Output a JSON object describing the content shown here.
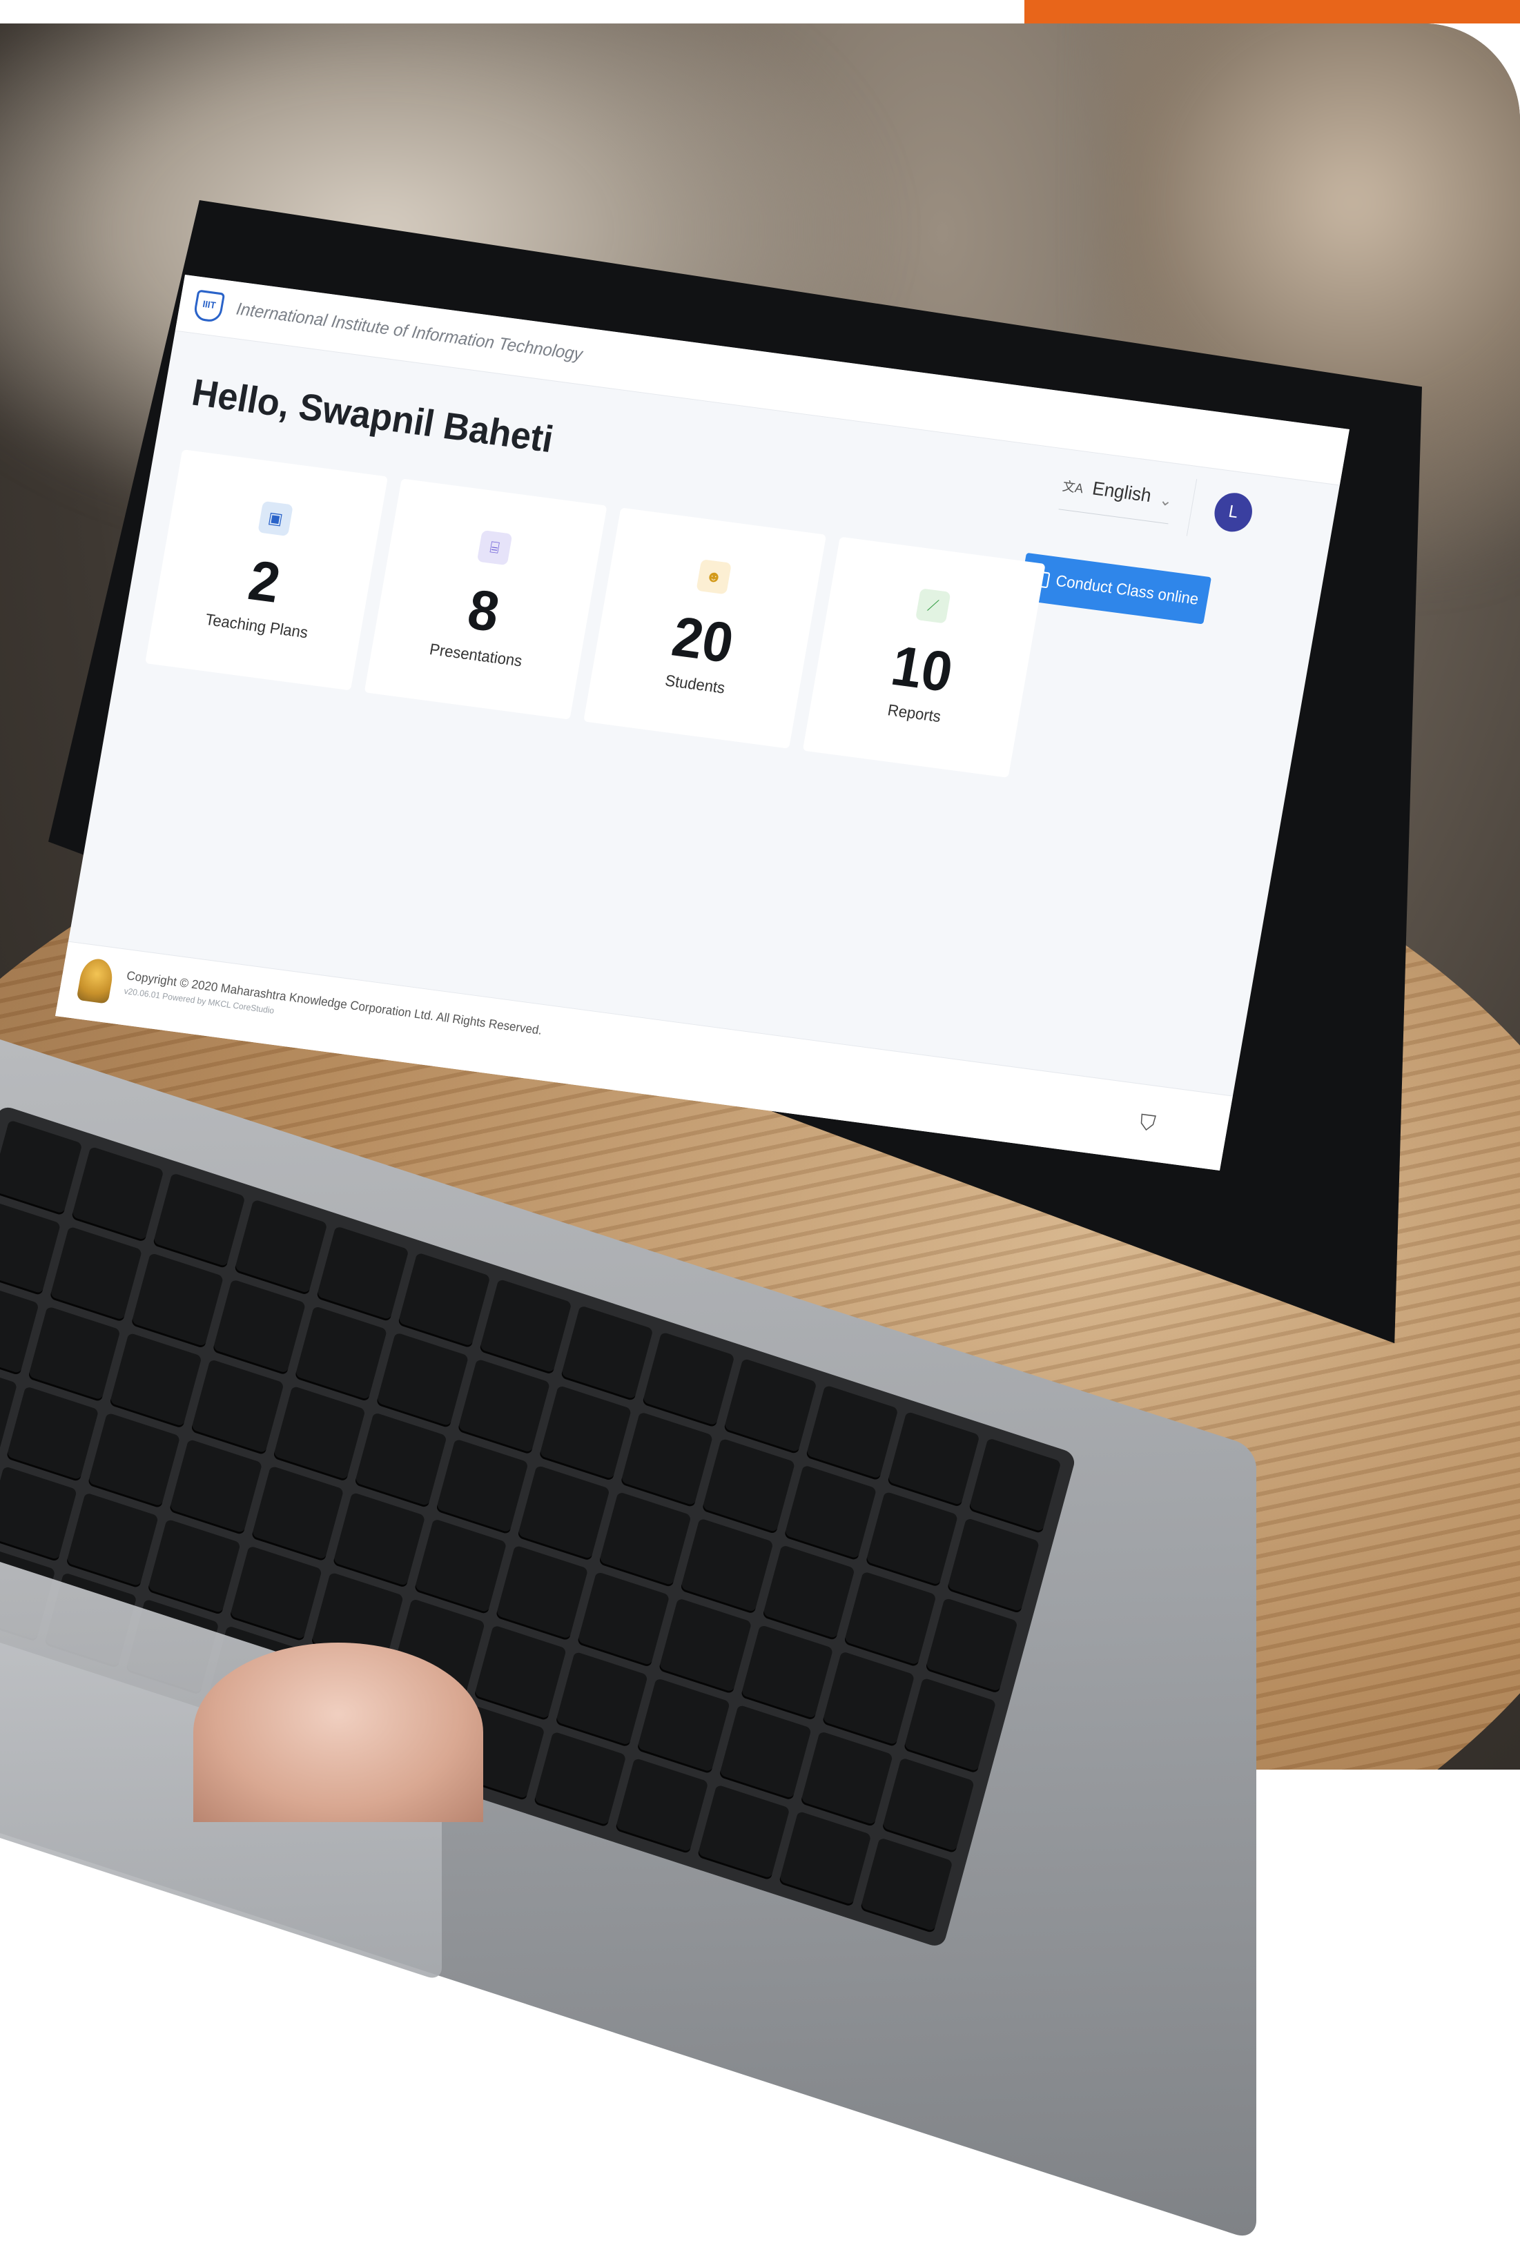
{
  "header": {
    "institution": "International Institute of Information Technology"
  },
  "greeting": "Hello, Swapnil Baheti",
  "language": {
    "selected": "English"
  },
  "avatar_initial": "L",
  "actions": {
    "conduct_class": "Conduct Class online"
  },
  "stats": [
    {
      "value": "2",
      "label": "Teaching Plans",
      "icon": "image-icon",
      "color": "#dbe8f8"
    },
    {
      "value": "8",
      "label": "Presentations",
      "icon": "presentation-icon",
      "color": "#e6e3f9"
    },
    {
      "value": "20",
      "label": "Students",
      "icon": "users-icon",
      "color": "#fcefd3"
    },
    {
      "value": "10",
      "label": "Reports",
      "icon": "chart-line-icon",
      "color": "#e2f3e2"
    }
  ],
  "footer": {
    "copyright": "Copyright © 2020 Maharashtra Knowledge Corporation Ltd. All Rights Reserved.",
    "version": "v20.06.01 Powered by MKCL CoreStudio"
  },
  "colors": {
    "accent": "#2f86ea",
    "brand_orange": "#e8651a",
    "avatar": "#3a3fa0"
  }
}
